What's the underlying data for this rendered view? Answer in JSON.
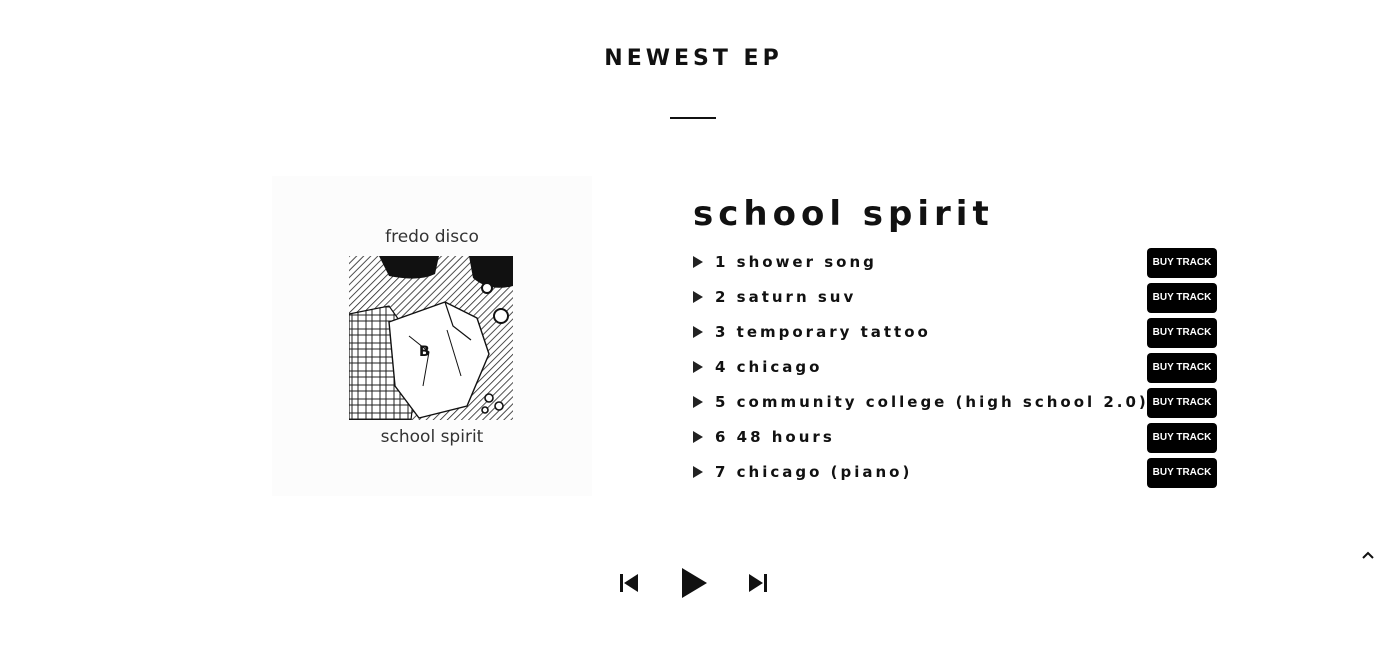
{
  "section": {
    "title": "NEWEST EP"
  },
  "cover": {
    "artist": "fredo disco",
    "album": "school spirit"
  },
  "album": {
    "title": "school spirit"
  },
  "tracks": [
    {
      "label": "1 shower song",
      "buy": "BUY TRACK"
    },
    {
      "label": "2 saturn suv",
      "buy": "BUY TRACK"
    },
    {
      "label": "3 temporary tattoo",
      "buy": "BUY TRACK"
    },
    {
      "label": "4 chicago",
      "buy": "BUY TRACK"
    },
    {
      "label": "5 community college (high school 2.0)",
      "buy": "BUY TRACK"
    },
    {
      "label": "6 48 hours",
      "buy": "BUY TRACK"
    },
    {
      "label": "7 chicago (piano)",
      "buy": "BUY TRACK"
    }
  ],
  "player": {
    "icons": [
      "previous-icon",
      "play-icon",
      "next-icon"
    ]
  },
  "back_to_top_icon": "chevron-up-icon",
  "colors": {
    "text": "#111111",
    "button_bg": "#000000",
    "button_text": "#ffffff",
    "background": "#ffffff"
  }
}
